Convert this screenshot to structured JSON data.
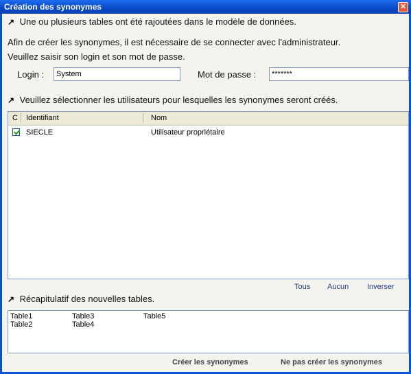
{
  "window": {
    "title": "Création des synonymes",
    "close_symbol": "✕"
  },
  "intro": {
    "bullet1": "Une ou plusieurs tables ont été rajoutées dans le modèle de données.",
    "line1": "Afin de créer les synonymes, il est nécessaire de se connecter avec l'administrateur.",
    "line2": "Veuillez saisir son login et son mot de passe."
  },
  "login": {
    "label": "Login :",
    "value": "System"
  },
  "password": {
    "label": "Mot de passe :",
    "value": "*******"
  },
  "users_section": {
    "heading": "Veuillez sélectionner les utilisateurs pour lesquelles les synonymes seront créés.",
    "columns": {
      "c": "C",
      "id": "Identifiant",
      "name": "Nom"
    },
    "rows": [
      {
        "checked": true,
        "id": "SIECLE",
        "name": "Utilisateur propriétaire"
      }
    ],
    "links": {
      "all": "Tous",
      "none": "Aucun",
      "invert": "Inverser"
    }
  },
  "tables_section": {
    "heading": "Récapitulatif des nouvelles tables.",
    "tables": [
      "Table1",
      "Table2",
      "Table3",
      "Table4",
      "Table5"
    ]
  },
  "buttons": {
    "create": "Créer les synonymes",
    "no_create": "Ne pas créer les synonymes"
  },
  "colors": {
    "titlebar": "#0849c6",
    "link": "#1f3f8f",
    "check": "#21a121"
  },
  "icons": {
    "bullet": "arrow-bullet-icon"
  }
}
